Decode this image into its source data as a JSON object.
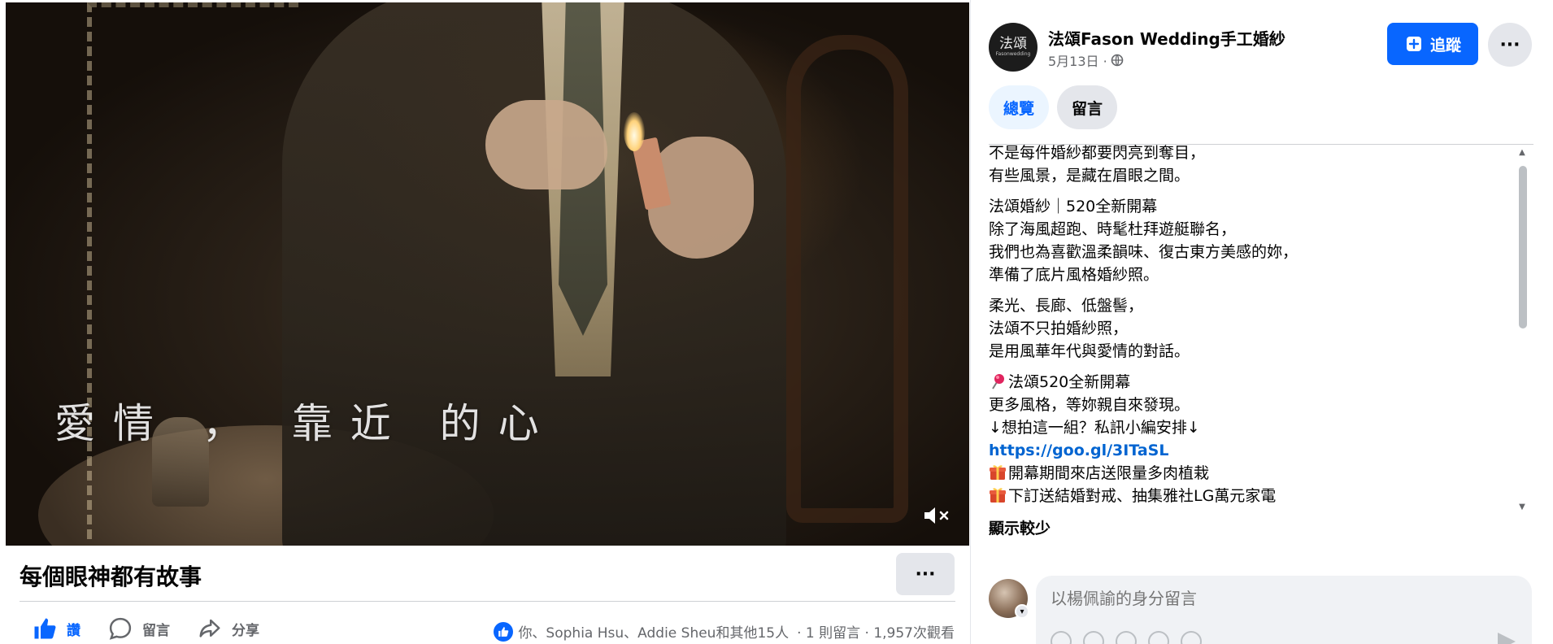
{
  "video": {
    "subtitle": "愛情 ， 靠近 的心",
    "mute_icon": "🔇×"
  },
  "video_info": {
    "title": "每個眼神都有故事",
    "more_label": "···"
  },
  "actions": {
    "like_label": "讚",
    "comment_label": "留言",
    "share_label": "分享"
  },
  "reactions": {
    "people": "你、Sophia Hsu、Addie Sheu和其他15人",
    "stats": "· 1 則留言 · 1,957次觀看"
  },
  "post": {
    "page_name": "法頌Fason Wedding手工婚紗",
    "date": "5月13日 ·",
    "avatar_main": "法頌",
    "avatar_sub": "Fasonwedding",
    "follow_label": "追蹤",
    "more_label": "···",
    "tabs": [
      {
        "label": "總覽"
      },
      {
        "label": "留言"
      }
    ],
    "paragraphs": [
      [
        "不是每件婚紗都要閃亮到奪目，",
        "有些風景，是藏在眉眼之間。"
      ],
      [
        "法頌婚紗｜520全新開幕",
        "除了海風超跑、時髦杜拜遊艇聯名，",
        "我們也為喜歡溫柔韻味、復古東方美感的妳，",
        "準備了底片風格婚紗照。"
      ],
      [
        "柔光、長廊、低盤髻，",
        "法頌不只拍婚紗照，",
        "是用風華年代與愛情的對話。"
      ]
    ],
    "promo": {
      "line1": "法頌520全新開幕",
      "line2": "更多風格，等妳親自來發現。",
      "line3": "↓想拍這一組？私訊小編安排↓",
      "link": "https://goo.gl/3ITaSL",
      "gift1": "開幕期間來店送限量多肉植栽",
      "gift2": "下訂送結婚對戒、抽集雅社LG萬元家電"
    },
    "show_less": "顯示較少"
  },
  "comment": {
    "placeholder": "以楊佩諭的身分留言"
  },
  "colors": {
    "accent": "#0866ff",
    "link": "#0064d1",
    "secondary_text": "#65676b",
    "button_bg": "#e4e6eb"
  }
}
